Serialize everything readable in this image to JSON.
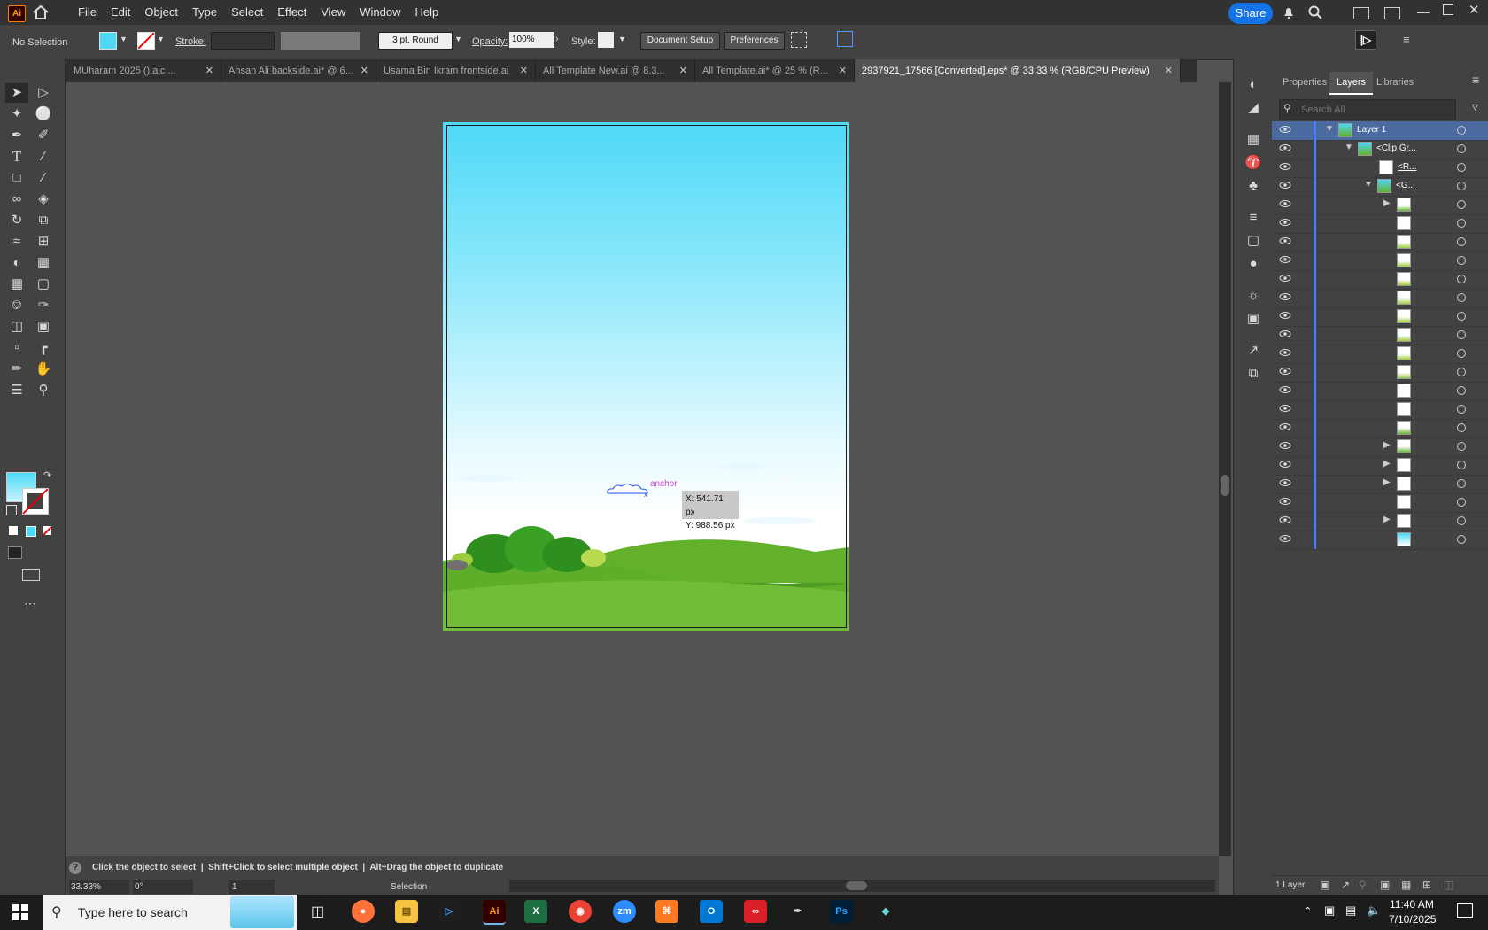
{
  "menu": {
    "logo": "Ai",
    "items": [
      "File",
      "Edit",
      "Object",
      "Type",
      "Select",
      "Effect",
      "View",
      "Window",
      "Help"
    ],
    "share_label": "Share"
  },
  "control": {
    "selection": "No Selection",
    "stroke_label": "Stroke:",
    "brush": "3 pt. Round",
    "opacity_label": "Opacity:",
    "opacity_value": "100%",
    "style_label": "Style:",
    "doc_setup": "Document Setup",
    "preferences": "Preferences"
  },
  "tabs": [
    {
      "label": "MUharam 2025 ().aic ...",
      "active": false
    },
    {
      "label": "Ahsan Ali backside.ai* @ 6...",
      "active": false
    },
    {
      "label": "Usama Bin Ikram frontside.ai",
      "active": false
    },
    {
      "label": "All Template New.ai @ 8.3...",
      "active": false
    },
    {
      "label": "All Template.ai* @ 25 % (R...",
      "active": false
    },
    {
      "label": "2937921_17566 [Converted].eps* @ 33.33 % (RGB/CPU Preview)",
      "active": true
    }
  ],
  "canvas": {
    "anchor_label": "anchor",
    "x_readout": "X: 541.71 px",
    "y_readout": "Y: 988.56 px"
  },
  "status": {
    "hint": "Click the object to select  |  Shift+Click to select multiple object  |  Alt+Drag the object to duplicate",
    "zoom": "33.33%",
    "rotation": "0°",
    "artboard": "1",
    "tool": "Selection"
  },
  "panel": {
    "tabs": [
      "Properties",
      "Layers",
      "Libraries"
    ],
    "search_placeholder": "Search All",
    "layer1": "Layer 1",
    "clip_group": "<Clip Gr...",
    "rect": "<R...",
    "group": "<G...",
    "footer": "1 Layer"
  },
  "taskbar": {
    "search": "Type here to search",
    "time": "11:40 AM",
    "date": "7/10/2025"
  },
  "colors": {
    "accent": "#1473e6",
    "fill_swatch": "#4dd9f7",
    "layer_bar": "#4d7cff"
  }
}
